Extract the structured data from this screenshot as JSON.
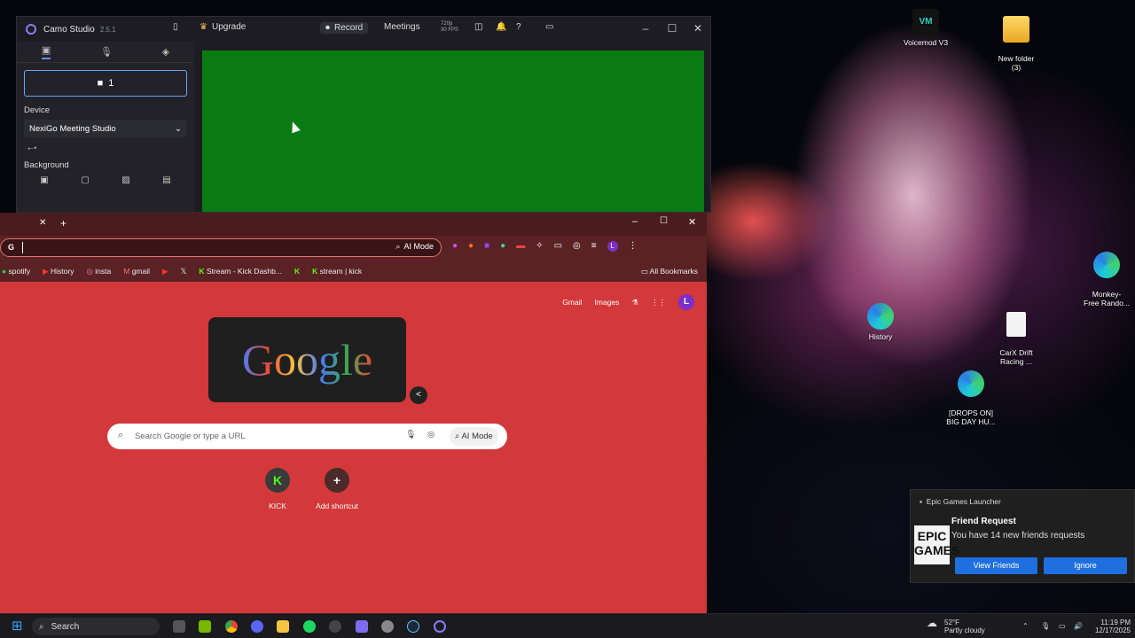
{
  "desktop": {
    "icons": {
      "voicemod": "Voicemod V3",
      "new_folder": "New folder\n(3)",
      "monkey": "Monkey-\nFree Rando...",
      "history": "History",
      "carx": "CarX Drift\nRacing ...",
      "drops": "[DROPS ON]\nBIG DAY HU..."
    }
  },
  "camo": {
    "app_name": "Camo Studio",
    "version": "2.5.1",
    "upgrade": "Upgrade",
    "record": "Record",
    "meetings": "Meetings",
    "resolution_badge": "720p\n30 FPS",
    "camera_button": "1",
    "device_label": "Device",
    "device_value": "NexiGo Meeting Studio",
    "background_label": "Background",
    "preview_color": "#0a7a12"
  },
  "chrome": {
    "omnibox_ai_mode": "AI Mode",
    "bookmarks": [
      "spotify",
      "History",
      "insta",
      "gmail",
      "",
      "",
      "Stream - Kick Dashb...",
      "",
      "stream | kick"
    ],
    "all_bookmarks": "All Bookmarks",
    "ntp": {
      "gmail": "Gmail",
      "images": "Images",
      "avatar": "L",
      "doodle_text": "Google",
      "search_placeholder": "Search Google or type a URL",
      "search_ai_mode": "AI Mode",
      "shortcuts": [
        {
          "label": "KICK",
          "glyph": "K"
        },
        {
          "label": "Add shortcut",
          "glyph": "+"
        }
      ]
    },
    "theme_color": "#d3383a"
  },
  "notification": {
    "app": "Epic Games Launcher",
    "title": "Friend Request",
    "body": "You have 14 new friends requests",
    "logo_text": "EPIC\nGAMES",
    "view_button": "View Friends",
    "ignore_button": "Ignore"
  },
  "taskbar": {
    "search": "Search",
    "weather_temp": "52°F",
    "weather_desc": "Partly cloudy",
    "time": "11:19 PM",
    "date": "12/17/2025"
  }
}
